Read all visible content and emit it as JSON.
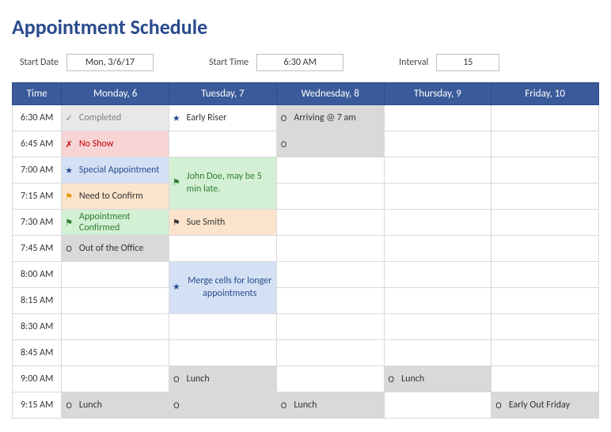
{
  "title": "Appointment Schedule",
  "controls": {
    "start_date_label": "Start Date",
    "start_date_value": "Mon, 3/6/17",
    "start_time_label": "Start Time",
    "start_time_value": "6:30 AM",
    "interval_label": "Interval",
    "interval_value": "15"
  },
  "headers": {
    "time": "Time",
    "mon": "Monday, 6",
    "tue": "Tuesday, 7",
    "wed": "Wednesday, 8",
    "thu": "Thursday, 9",
    "fri": "Friday, 10"
  },
  "times": {
    "r0": "6:30 AM",
    "r1": "6:45 AM",
    "r2": "7:00 AM",
    "r3": "7:15 AM",
    "r4": "7:30 AM",
    "r5": "7:45 AM",
    "r6": "8:00 AM",
    "r7": "8:15 AM",
    "r8": "8:30 AM",
    "r9": "8:45 AM",
    "r10": "9:00 AM",
    "r11": "9:15 AM"
  },
  "cells": {
    "mon_r0": "Completed",
    "mon_r1": "No Show",
    "mon_r2": "Special Appointment",
    "mon_r3": "Need to Confirm",
    "mon_r4": "Appointment Confirmed",
    "mon_r5": "Out of the Office",
    "mon_r11": "Lunch",
    "tue_r0": "Early Riser",
    "tue_r2": "John Doe, may be 5 min late.",
    "tue_r4": "Sue Smith",
    "tue_r6": "Merge cells for longer appointments",
    "tue_r10": "Lunch",
    "wed_r0": "Arriving @ 7 am",
    "wed_r11": "Lunch",
    "thu_r10": "Lunch",
    "fri_r11": "Early Out Friday"
  },
  "icons": {
    "check": "✓",
    "x": "✗",
    "star": "★",
    "flag_open": "⚑",
    "flag_solid": "⚑",
    "circle": "O"
  }
}
